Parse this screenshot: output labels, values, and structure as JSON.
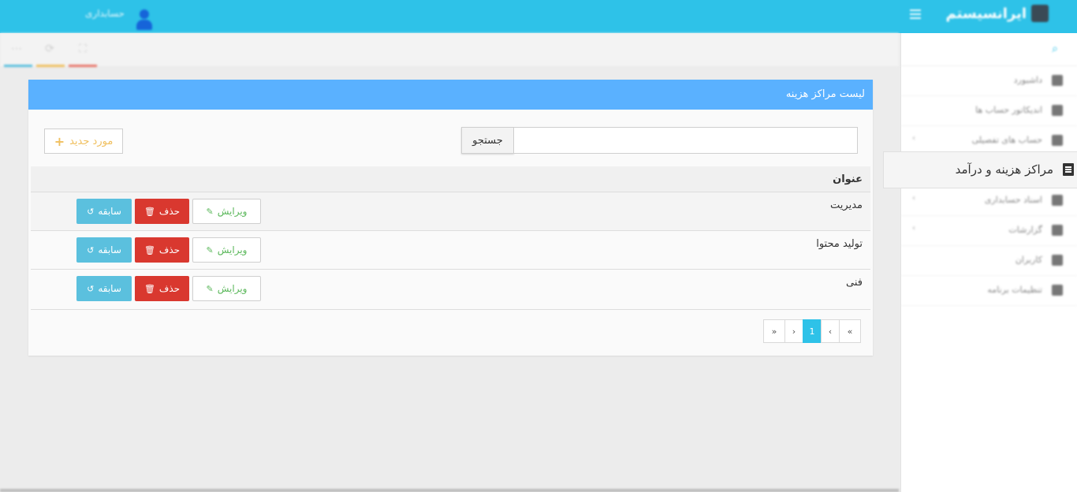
{
  "topbar": {
    "brand": "ایرانسیستم",
    "username": "حسابداری"
  },
  "sidebar": {
    "items": [
      {
        "label": "داشبورد",
        "has_children": false
      },
      {
        "label": "اندیکاتور حساب ها",
        "has_children": false
      },
      {
        "label": "حساب های تفصیلی",
        "has_children": true
      },
      {
        "label": "اسناد حسابداری",
        "has_children": true
      },
      {
        "label": "گزارشات",
        "has_children": true
      },
      {
        "label": "کاربران",
        "has_children": false
      },
      {
        "label": "تنظیمات برنامه",
        "has_children": false
      }
    ],
    "active_item": "مراکز هزینه و درآمد"
  },
  "panel": {
    "title": "لیست مراکز هزینه",
    "search_button": "جستجو",
    "search_value": "",
    "new_button": "مورد جدید",
    "table": {
      "header": "عنوان",
      "rows": [
        {
          "title": "مدیریت"
        },
        {
          "title": "تولید محتوا"
        },
        {
          "title": "فنی"
        }
      ],
      "actions": {
        "edit": "ویرایش",
        "delete": "حذف",
        "history": "سابقه"
      }
    },
    "pagination": {
      "first": "«",
      "prev": "‹",
      "current": "1",
      "next": "›",
      "last": "»"
    }
  },
  "colors": {
    "topbar": "#2ec2e8",
    "panel_header": "#5ab1ff",
    "delete": "#d9382f",
    "history": "#5bc0de",
    "edit_text": "#5cb85c",
    "new_text": "#f0c060"
  }
}
